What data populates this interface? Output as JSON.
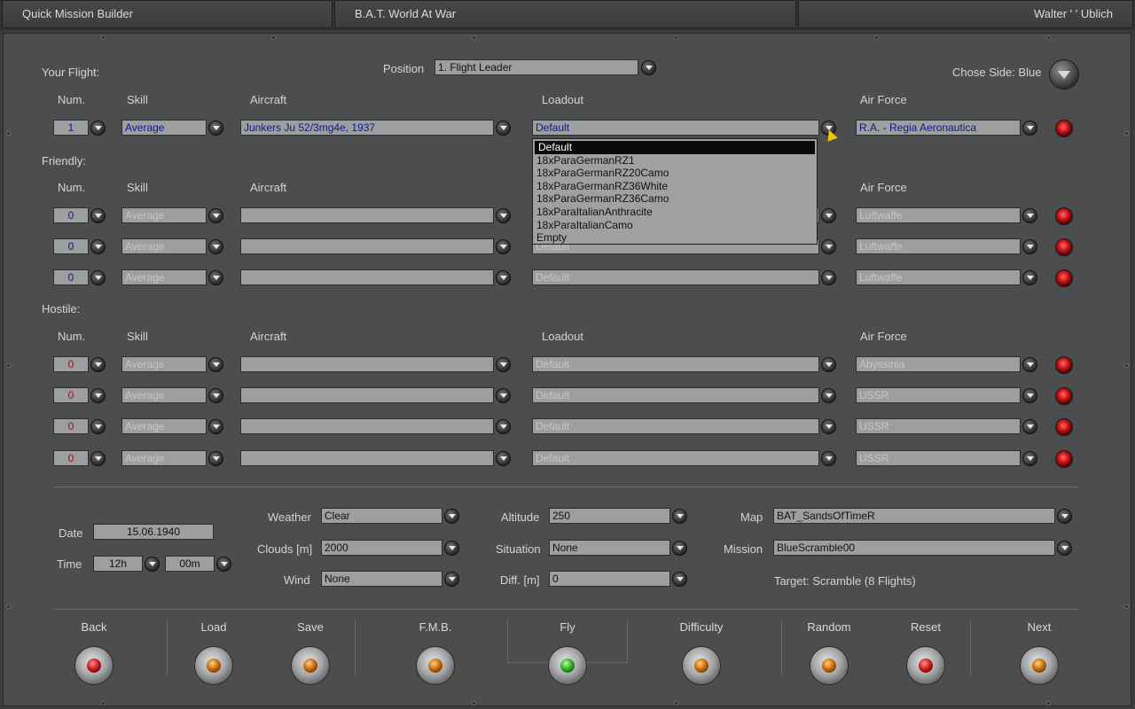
{
  "titlebar": {
    "left": "Quick Mission Builder",
    "center": "B.A.T. World At War",
    "right": "Walter ' ' Ublich"
  },
  "your_flight": {
    "label": "Your Flight:",
    "position_label": "Position",
    "position_value": "1. Flight Leader",
    "side_label": "Chose Side: Blue",
    "headers": {
      "num": "Num.",
      "skill": "Skill",
      "aircraft": "Aircraft",
      "loadout": "Loadout",
      "airforce": "Air Force"
    },
    "row": {
      "num": "1",
      "skill": "Average",
      "aircraft": "Junkers Ju 52/3mg4e, 1937",
      "loadout": "Default",
      "airforce": "R.A. - Regia Aeronautica"
    }
  },
  "loadout_dropdown": {
    "options": [
      "Default",
      "18xParaGermanRZ1",
      "18xParaGermanRZ20Camo",
      "18xParaGermanRZ36White",
      "18xParaGermanRZ36Camo",
      "18xParaItalianAnthracite",
      "18xParaItalianCamo",
      "Empty"
    ],
    "selected": "Default"
  },
  "friendly": {
    "label": "Friendly:",
    "headers": {
      "num": "Num.",
      "skill": "Skill",
      "aircraft": "Aircraft",
      "airforce": "Air Force"
    },
    "rows": [
      {
        "num": "0",
        "skill": "Average",
        "aircraft": "",
        "loadout": "",
        "airforce": "Luftwaffe"
      },
      {
        "num": "0",
        "skill": "Average",
        "aircraft": "",
        "loadout": "Default",
        "airforce": "Luftwaffe"
      },
      {
        "num": "0",
        "skill": "Average",
        "aircraft": "",
        "loadout": "Default",
        "airforce": "Luftwaffe"
      }
    ]
  },
  "hostile": {
    "label": "Hostile:",
    "headers": {
      "num": "Num.",
      "skill": "Skill",
      "aircraft": "Aircraft",
      "loadout": "Loadout",
      "airforce": "Air Force"
    },
    "rows": [
      {
        "num": "0",
        "skill": "Average",
        "aircraft": "",
        "loadout": "Default",
        "airforce": "Abyssinia"
      },
      {
        "num": "0",
        "skill": "Average",
        "aircraft": "",
        "loadout": "Default",
        "airforce": "USSR"
      },
      {
        "num": "0",
        "skill": "Average",
        "aircraft": "",
        "loadout": "Default",
        "airforce": "USSR"
      },
      {
        "num": "0",
        "skill": "Average",
        "aircraft": "",
        "loadout": "Default",
        "airforce": "USSR"
      }
    ]
  },
  "settings": {
    "date_label": "Date",
    "date_value": "15.06.1940",
    "time_label": "Time",
    "time_hour": "12h",
    "time_min": "00m",
    "weather_label": "Weather",
    "weather_value": "Clear",
    "clouds_label": "Clouds [m]",
    "clouds_value": "2000",
    "wind_label": "Wind",
    "wind_value": "None",
    "altitude_label": "Altitude",
    "altitude_value": "250",
    "situation_label": "Situation",
    "situation_value": "None",
    "diff_label": "Diff. [m]",
    "diff_value": "0",
    "map_label": "Map",
    "map_value": "BAT_SandsOfTimeR",
    "mission_label": "Mission",
    "mission_value": "BlueScramble00",
    "target_text": "Target: Scramble (8 Flights)"
  },
  "buttons": {
    "back": "Back",
    "load": "Load",
    "save": "Save",
    "fmb": "F.M.B.",
    "fly": "Fly",
    "difficulty": "Difficulty",
    "random": "Random",
    "reset": "Reset",
    "next": "Next"
  },
  "colors": {
    "value_blue": "#0f1a8a",
    "hostile_red": "#a01010",
    "panel": "#4b4d4f",
    "lamp_green": "#1f9a18"
  }
}
